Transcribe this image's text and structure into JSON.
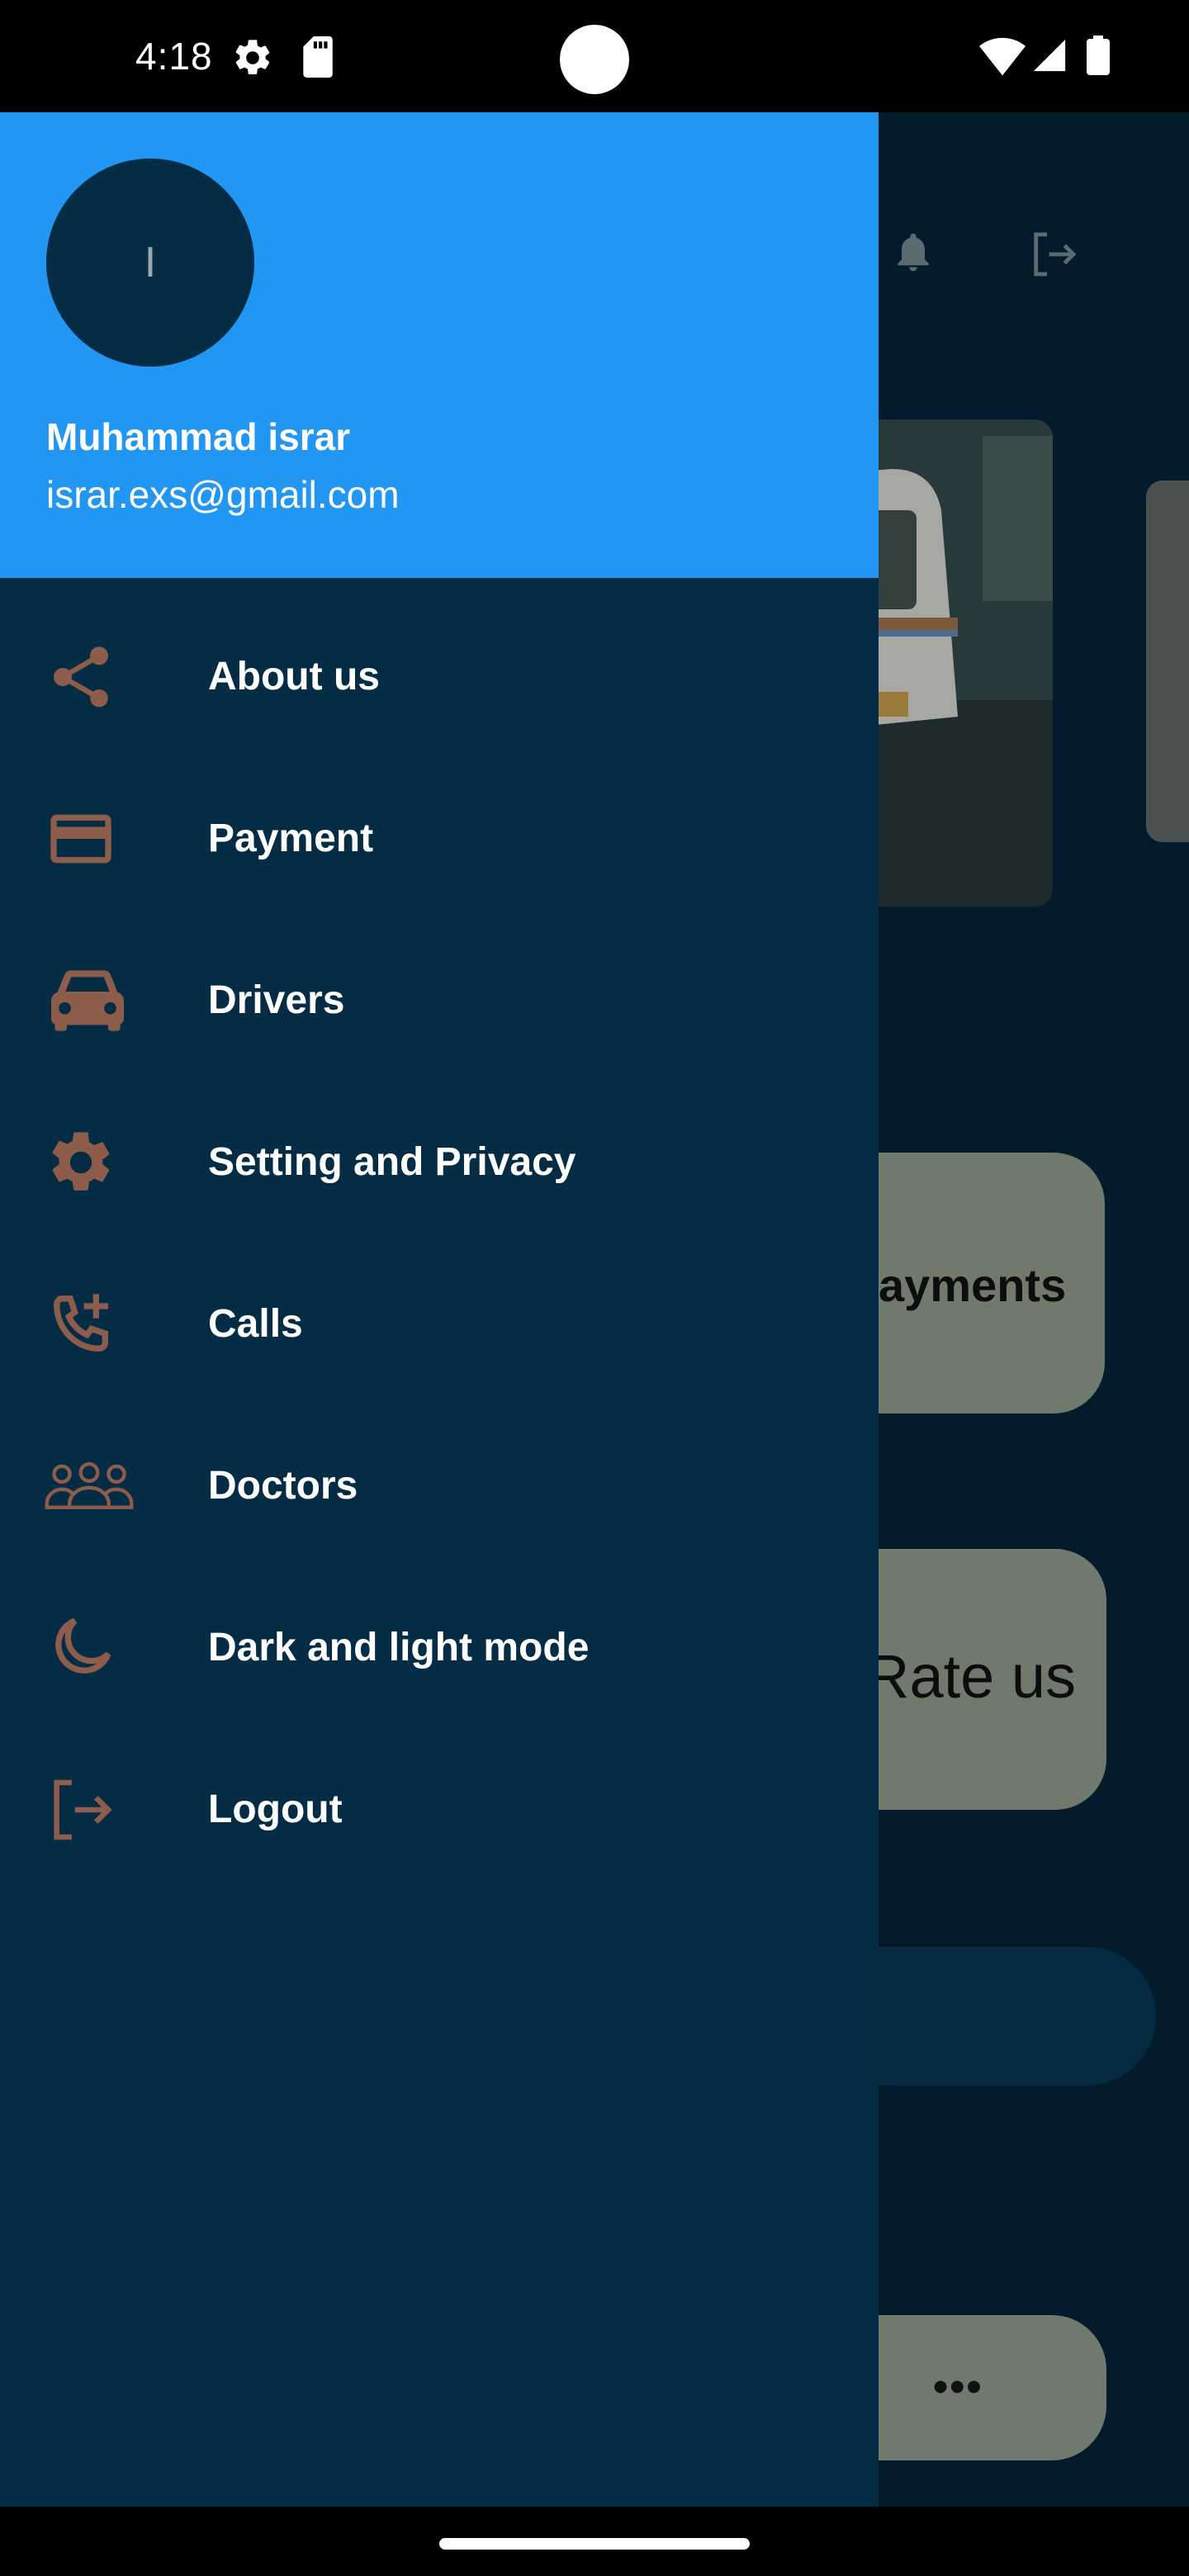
{
  "status_bar": {
    "time": "4:18",
    "icons": [
      "settings-gear-icon",
      "sd-card-icon",
      "wifi-icon",
      "cellular-signal-icon",
      "battery-icon"
    ]
  },
  "drawer": {
    "avatar_initial": "I",
    "user_name": "Muhammad israr",
    "user_email": "israr.exs@gmail.com",
    "items": [
      {
        "label": "About us",
        "icon": "share-icon"
      },
      {
        "label": "Payment",
        "icon": "credit-card-icon"
      },
      {
        "label": "Drivers",
        "icon": "car-icon"
      },
      {
        "label": "Setting and Privacy",
        "icon": "gear-icon"
      },
      {
        "label": "Calls",
        "icon": "add-call-icon"
      },
      {
        "label": "Doctors",
        "icon": "group-icon"
      },
      {
        "label": "Dark and light mode",
        "icon": "moon-icon"
      },
      {
        "label": "Logout",
        "icon": "logout-icon"
      }
    ]
  },
  "background": {
    "payments_label": "ayments",
    "rate_label": "Rate us",
    "more_label": "•••",
    "toolbar_icons": [
      "bell-icon",
      "logout-icon"
    ],
    "banner_image": "ambulance-image"
  },
  "colors": {
    "drawer_bg": "#042d45",
    "header_bg": "#2196f3",
    "icon_color": "#8d5c4a",
    "text": "#ffffff"
  }
}
